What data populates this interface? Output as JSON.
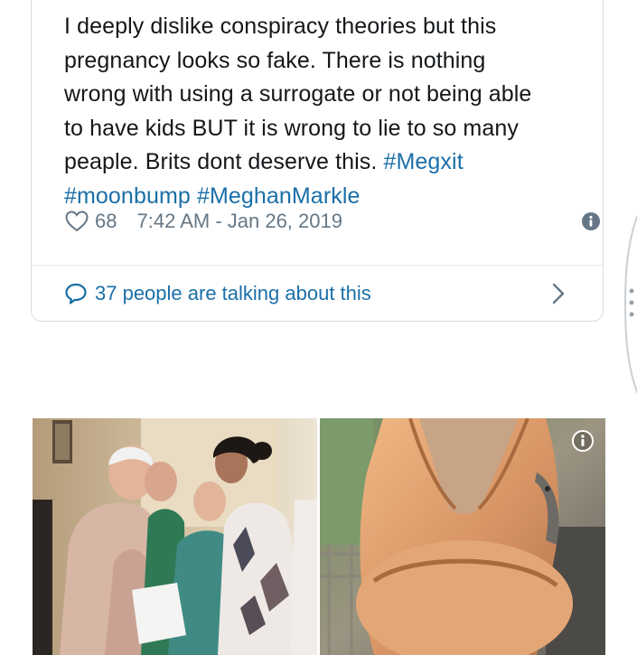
{
  "tweet": {
    "text_lines": [
      "I deeply dislike conspiracy theories but this",
      "pregnancy looks so fake. There is nothing",
      "wrong with using a surrogate or not being able",
      "to have kids BUT it is  wrong to lie to so many",
      "peaple. Brits dont deserve this. "
    ],
    "hashtags_line5": "#Megxit",
    "hashtags_line6_a": "#moonbump",
    "hashtags_line6_b": "#MeghanMarkle",
    "like_count": "68",
    "timestamp": "7:42 AM - Jan 26, 2019"
  },
  "talking": {
    "label": "37 people are talking about this"
  },
  "colors": {
    "link": "#1b6fa8",
    "text": "#14171a",
    "muted": "#657786",
    "border": "#d5dde3"
  },
  "icons": {
    "like": "heart-icon",
    "info": "info-icon",
    "reply": "speech-bubble-icon",
    "more": "chevron-right-icon",
    "photo_info": "info-icon"
  }
}
